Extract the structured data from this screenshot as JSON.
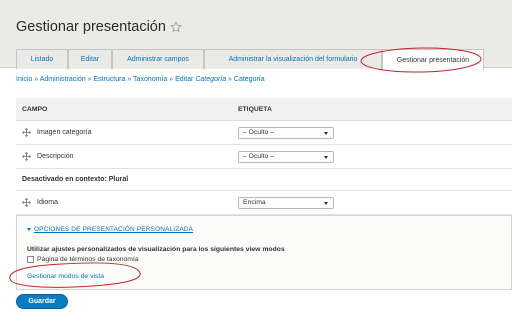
{
  "page": {
    "title": "Gestionar presentación"
  },
  "tabs": [
    {
      "label": "Listado"
    },
    {
      "label": "Editar"
    },
    {
      "label": "Administrar campos"
    },
    {
      "label": "Administrar la visualización del formulario"
    },
    {
      "label": "Gestionar presentación"
    }
  ],
  "breadcrumb": {
    "inicio": "Inicio",
    "administracion": "Administración",
    "estructura": "Estructura",
    "taxonomia": "Taxonomía",
    "editar": "Editar",
    "categoria_em": "Categoría",
    "categoria": "Categoría",
    "separator": "»"
  },
  "table": {
    "col_campo": "CAMPO",
    "col_etiqueta": "ETIQUETA",
    "rows": [
      {
        "field": "Imagen categoría",
        "label": "– Oculto –"
      },
      {
        "field": "Descripción",
        "label": "– Oculto –"
      }
    ],
    "disabled_region": "Desactivado en contexto: Plural",
    "disabled_rows": [
      {
        "field": "Idioma",
        "label": "Encima"
      }
    ]
  },
  "custom_display": {
    "summary": "OPCIONES DE PRESENTACIÓN PERSONALIZADA",
    "description": "Utilizar ajustes personalizados de visualización para los siguientes view modos",
    "checkbox_label": "Página de términos de taxonomía",
    "checkbox_checked": false,
    "manage_link": "Gestionar modos de vista"
  },
  "actions": {
    "save_label": "Guardar"
  },
  "colors": {
    "link": "#0074bd",
    "annotation": "#c0222a",
    "button": "#0c7dc4"
  }
}
